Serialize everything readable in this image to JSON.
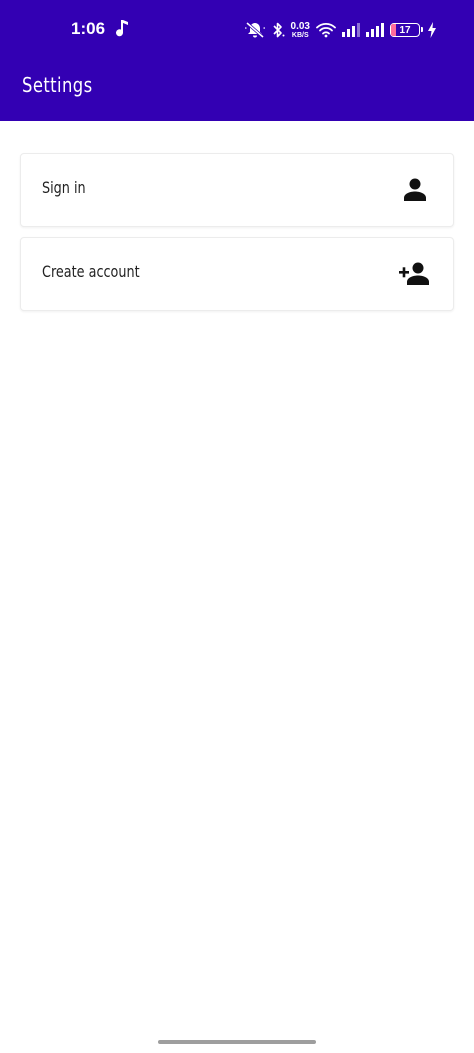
{
  "status_bar": {
    "time": "1:06",
    "net_speed_value": "0.03",
    "net_speed_unit": "KB/S",
    "battery_level": "17",
    "battery_fraction": 0.17,
    "icons": [
      "music-note-icon",
      "mute-icon",
      "bluetooth-icon",
      "wifi-icon",
      "signal-icon",
      "signal-icon",
      "battery-icon",
      "charging-icon"
    ]
  },
  "app_bar": {
    "title": "Settings",
    "color": "#3300b3"
  },
  "settings_items": [
    {
      "label": "Sign in",
      "icon": "person-icon"
    },
    {
      "label": "Create account",
      "icon": "person-add-icon"
    }
  ]
}
